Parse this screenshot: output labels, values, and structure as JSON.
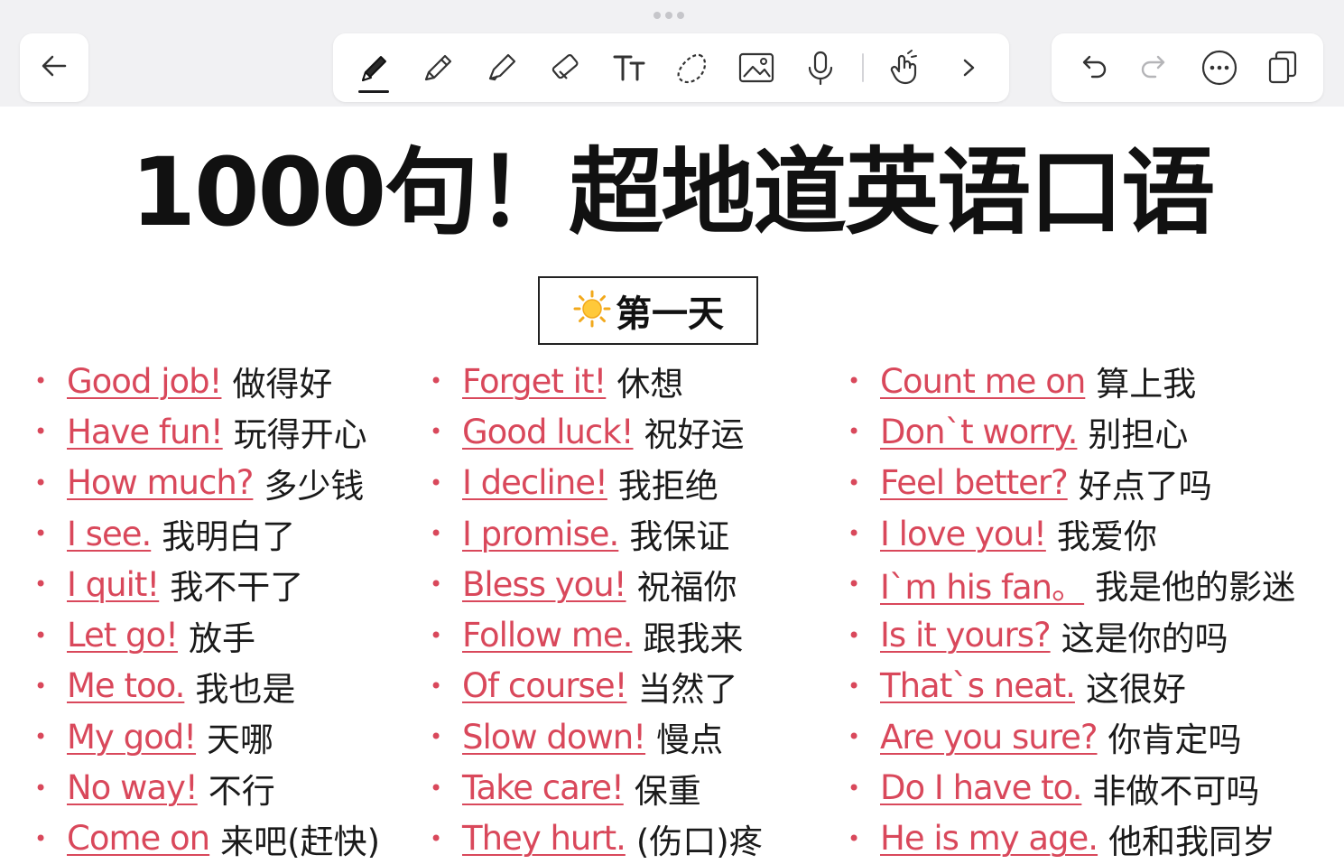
{
  "toolbar": {
    "tools": [
      {
        "name": "pen",
        "active": true
      },
      {
        "name": "pencil"
      },
      {
        "name": "highlighter"
      },
      {
        "name": "eraser"
      },
      {
        "name": "text"
      },
      {
        "name": "lasso"
      },
      {
        "name": "image"
      },
      {
        "name": "microphone"
      },
      {
        "name": "touch-gesture"
      },
      {
        "name": "more-chevron"
      }
    ],
    "right_actions": [
      "undo",
      "redo",
      "more",
      "pages"
    ]
  },
  "colors": {
    "accent_red": "#d9485b",
    "text_dark": "#111111",
    "toolbar_bg": "#f1f1f3"
  },
  "document": {
    "title": "1000句！超地道英语口语",
    "day_label": "第一天",
    "columns": [
      [
        {
          "en": "Good job!",
          "zh": "做得好"
        },
        {
          "en": "Have fun!",
          "zh": "玩得开心"
        },
        {
          "en": "How much?",
          "zh": "多少钱"
        },
        {
          "en": "I see.",
          "zh": "我明白了"
        },
        {
          "en": "I quit!",
          "zh": "我不干了"
        },
        {
          "en": "Let go!",
          "zh": "放手"
        },
        {
          "en": "Me too.",
          "zh": "我也是"
        },
        {
          "en": "My god!",
          "zh": "天哪"
        },
        {
          "en": "No way!",
          "zh": "不行"
        },
        {
          "en": "Come on",
          "zh": "来吧(赶快)"
        }
      ],
      [
        {
          "en": "Forget it!",
          "zh": "休想"
        },
        {
          "en": "Good luck!",
          "zh": "祝好运"
        },
        {
          "en": "I decline!",
          "zh": "我拒绝"
        },
        {
          "en": "I promise.",
          "zh": "我保证"
        },
        {
          "en": "Bless you!",
          "zh": "祝福你"
        },
        {
          "en": "Follow me.",
          "zh": "跟我来"
        },
        {
          "en": "Of course!",
          "zh": "当然了"
        },
        {
          "en": "Slow down!",
          "zh": "慢点"
        },
        {
          "en": "Take care!",
          "zh": "保重"
        },
        {
          "en": "They hurt.",
          "zh": "(伤口)疼"
        }
      ],
      [
        {
          "en": "Count me on",
          "zh": "算上我"
        },
        {
          "en": "Don`t worry.",
          "zh": "别担心"
        },
        {
          "en": "Feel better?",
          "zh": "好点了吗"
        },
        {
          "en": "I love you!",
          "zh": "我爱你"
        },
        {
          "en": "I`m his fan。",
          "zh": "我是他的影迷"
        },
        {
          "en": "Is it yours?",
          "zh": "这是你的吗"
        },
        {
          "en": "That`s neat.",
          "zh": "这很好"
        },
        {
          "en": "Are you sure?",
          "zh": "你肯定吗"
        },
        {
          "en": "Do I have to.",
          "zh": "非做不可吗"
        },
        {
          "en": "He is my age.",
          "zh": "他和我同岁"
        }
      ]
    ]
  }
}
